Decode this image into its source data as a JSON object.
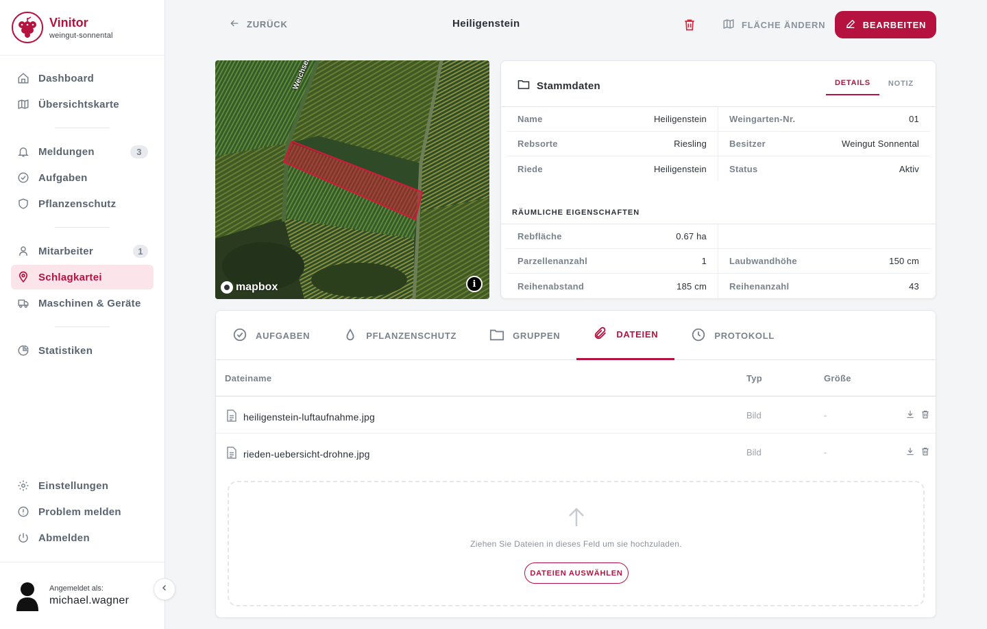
{
  "brand": {
    "name": "Vinitor",
    "tenant": "weingut-sonnental"
  },
  "sidebar": {
    "items": [
      {
        "label": "Dashboard",
        "icon": "home-icon"
      },
      {
        "label": "Übersichtskarte",
        "icon": "map-icon"
      },
      {
        "label": "Meldungen",
        "icon": "bell-icon",
        "badge": "3"
      },
      {
        "label": "Aufgaben",
        "icon": "check-circle-icon"
      },
      {
        "label": "Pflanzenschutz",
        "icon": "shield-icon"
      },
      {
        "label": "Mitarbeiter",
        "icon": "user-icon",
        "badge": "1"
      },
      {
        "label": "Schlagkartei",
        "icon": "location-pin-icon",
        "active": true
      },
      {
        "label": "Maschinen & Geräte",
        "icon": "truck-icon"
      },
      {
        "label": "Statistiken",
        "icon": "pie-chart-icon"
      }
    ],
    "footer_items": [
      {
        "label": "Einstellungen",
        "icon": "gear-icon"
      },
      {
        "label": "Problem melden",
        "icon": "alert-circle-icon"
      },
      {
        "label": "Abmelden",
        "icon": "power-icon"
      }
    ],
    "user": {
      "caption": "Angemeldet als:",
      "name": "michael.wagner"
    }
  },
  "header": {
    "back_label": "ZURÜCK",
    "title": "Heiligenstein",
    "area_label": "FLÄCHE ÄNDERN",
    "edit_label": "BEARBEITEN"
  },
  "map": {
    "road_label": "Weichselgraben",
    "attribution": "mapbox"
  },
  "stammdaten": {
    "title": "Stammdaten",
    "tabs": [
      "DETAILS",
      "NOTIZ"
    ],
    "rows": [
      {
        "k1": "Name",
        "v1": "Heiligenstein",
        "k2": "Weingarten-Nr.",
        "v2": "01"
      },
      {
        "k1": "Rebsorte",
        "v1": "Riesling",
        "k2": "Besitzer",
        "v2": "Weingut Sonnental"
      },
      {
        "k1": "Riede",
        "v1": "Heiligenstein",
        "k2": "Status",
        "v2": "Aktiv"
      }
    ],
    "spatial_title": "RÄUMLICHE EIGENSCHAFTEN",
    "spatial_rows": [
      {
        "k1": "Rebfläche",
        "v1": "0.67 ha",
        "k2": "",
        "v2": ""
      },
      {
        "k1": "Parzellenanzahl",
        "v1": "1",
        "k2": "Laubwandhöhe",
        "v2": "150 cm"
      },
      {
        "k1": "Reihenabstand",
        "v1": "185 cm",
        "k2": "Reihenanzahl",
        "v2": "43"
      }
    ]
  },
  "files_panel": {
    "tabs": [
      "AUFGABEN",
      "PFLANZENSCHUTZ",
      "GRUPPEN",
      "DATEIEN",
      "PROTOKOLL"
    ],
    "columns": {
      "name": "Dateiname",
      "type": "Typ",
      "size": "Größe"
    },
    "files": [
      {
        "name": "heiligenstein-luftaufnahme.jpg",
        "type": "Bild",
        "size": "-"
      },
      {
        "name": "rieden-uebersicht-drohne.jpg",
        "type": "Bild",
        "size": "-"
      }
    ],
    "dropzone_text": "Ziehen Sie Dateien in dieses Feld um sie hochzuladen.",
    "dropzone_button": "DATEIEN AUSWÄHLEN"
  },
  "colors": {
    "accent": "#b5123f",
    "accent_light": "#fbe4ea",
    "muted": "#7a828c"
  }
}
